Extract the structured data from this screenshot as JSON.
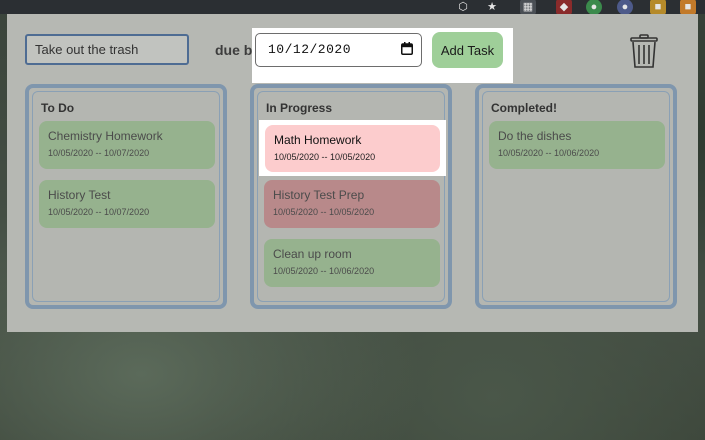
{
  "form": {
    "task_value": "Take out the trash",
    "due_label": "due by",
    "date_value": "10/12/2020",
    "add_button": "Add Task"
  },
  "columns": [
    {
      "title": "To Do",
      "cards": [
        {
          "title": "Chemistry Homework",
          "dates": "10/05/2020 -- 10/07/2020"
        },
        {
          "title": "History Test",
          "dates": "10/05/2020 -- 10/07/2020"
        }
      ]
    },
    {
      "title": "In Progress",
      "cards": [
        {
          "title": "Math Homework",
          "dates": "10/05/2020 -- 10/05/2020"
        },
        {
          "title": "History Test Prep",
          "dates": "10/05/2020 -- 10/05/2020"
        },
        {
          "title": "Clean up room",
          "dates": "10/05/2020 -- 10/06/2020"
        }
      ]
    },
    {
      "title": "Completed!",
      "cards": [
        {
          "title": "Do the dishes",
          "dates": "10/05/2020 -- 10/06/2020"
        }
      ]
    }
  ],
  "colors": {
    "card_green": "#96b28e",
    "card_pink_highlight": "#fccccd",
    "card_pink_dim": "#b8898a",
    "button_green": "#9fcf99",
    "column_border": "#7f96ad"
  },
  "icons": {
    "trash": "trash-icon",
    "calendar": "calendar-icon"
  }
}
